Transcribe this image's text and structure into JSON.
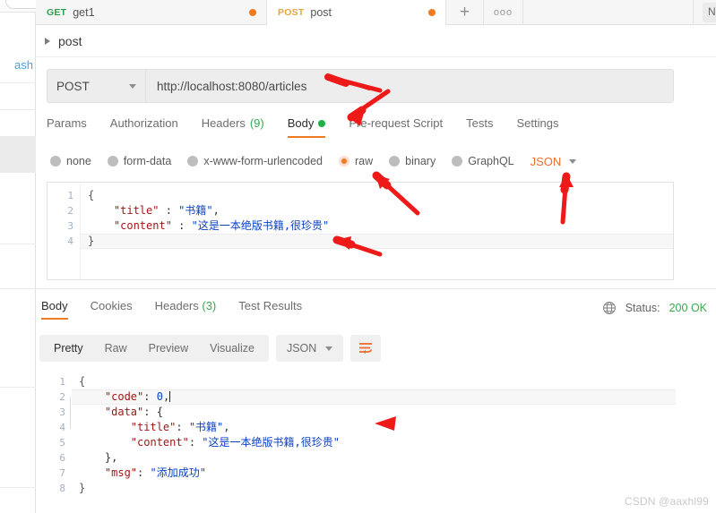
{
  "sidebar": {
    "trash_label": "ash"
  },
  "tabstrip": {
    "tabs": [
      {
        "method": "GET",
        "name": "get1",
        "unsaved": true
      },
      {
        "method": "POST",
        "name": "post",
        "unsaved": true
      }
    ],
    "add_label": "+",
    "more_label": "ooo",
    "environment_label": "No Environment"
  },
  "request": {
    "name": "post",
    "method": "POST",
    "url": "http://localhost:8080/articles",
    "tabs": [
      {
        "label": "Params"
      },
      {
        "label": "Authorization"
      },
      {
        "label": "Headers",
        "count": "(9)"
      },
      {
        "label": "Body",
        "active": true,
        "has_dot": true
      },
      {
        "label": "Pre-request Script"
      },
      {
        "label": "Tests"
      },
      {
        "label": "Settings"
      }
    ],
    "body_types": [
      {
        "label": "none",
        "selected": false
      },
      {
        "label": "form-data",
        "selected": false
      },
      {
        "label": "x-www-form-urlencoded",
        "selected": false
      },
      {
        "label": "raw",
        "selected": true
      },
      {
        "label": "binary",
        "selected": false
      },
      {
        "label": "GraphQL",
        "selected": false
      }
    ],
    "raw_format": "JSON",
    "body_lines": [
      {
        "n": "1",
        "text": "{"
      },
      {
        "n": "2",
        "text": "    \"title\" : \"书籍\","
      },
      {
        "n": "3",
        "text": "    \"content\" : \"这是一本绝版书籍,很珍贵\""
      },
      {
        "n": "4",
        "text": "}"
      }
    ]
  },
  "response": {
    "tabs": [
      {
        "label": "Body",
        "active": true
      },
      {
        "label": "Cookies"
      },
      {
        "label": "Headers",
        "count": "(3)"
      },
      {
        "label": "Test Results"
      }
    ],
    "status_label": "Status:",
    "status_value": "200 OK",
    "view_modes": [
      {
        "label": "Pretty",
        "active": true
      },
      {
        "label": "Raw"
      },
      {
        "label": "Preview"
      },
      {
        "label": "Visualize"
      }
    ],
    "format": "JSON",
    "body_lines": [
      {
        "n": "1",
        "text": "{"
      },
      {
        "n": "2",
        "text": "    \"code\": 0,"
      },
      {
        "n": "3",
        "text": "    \"data\": {"
      },
      {
        "n": "4",
        "text": "        \"title\": \"书籍\","
      },
      {
        "n": "5",
        "text": "        \"content\": \"这是一本绝版书籍,很珍贵\""
      },
      {
        "n": "6",
        "text": "    },"
      },
      {
        "n": "7",
        "text": "    \"msg\": \"添加成功\""
      },
      {
        "n": "8",
        "text": "}"
      }
    ]
  },
  "watermark": "CSDN @aaxhl99",
  "colors": {
    "accent_orange": "#ef7b21",
    "status_green": "#3aa84f",
    "get_green": "#2aa34a",
    "post_orange": "#e8a33d",
    "annotation_red": "#f01414",
    "json_key": "#a31515",
    "json_string": "#0b42c4"
  }
}
